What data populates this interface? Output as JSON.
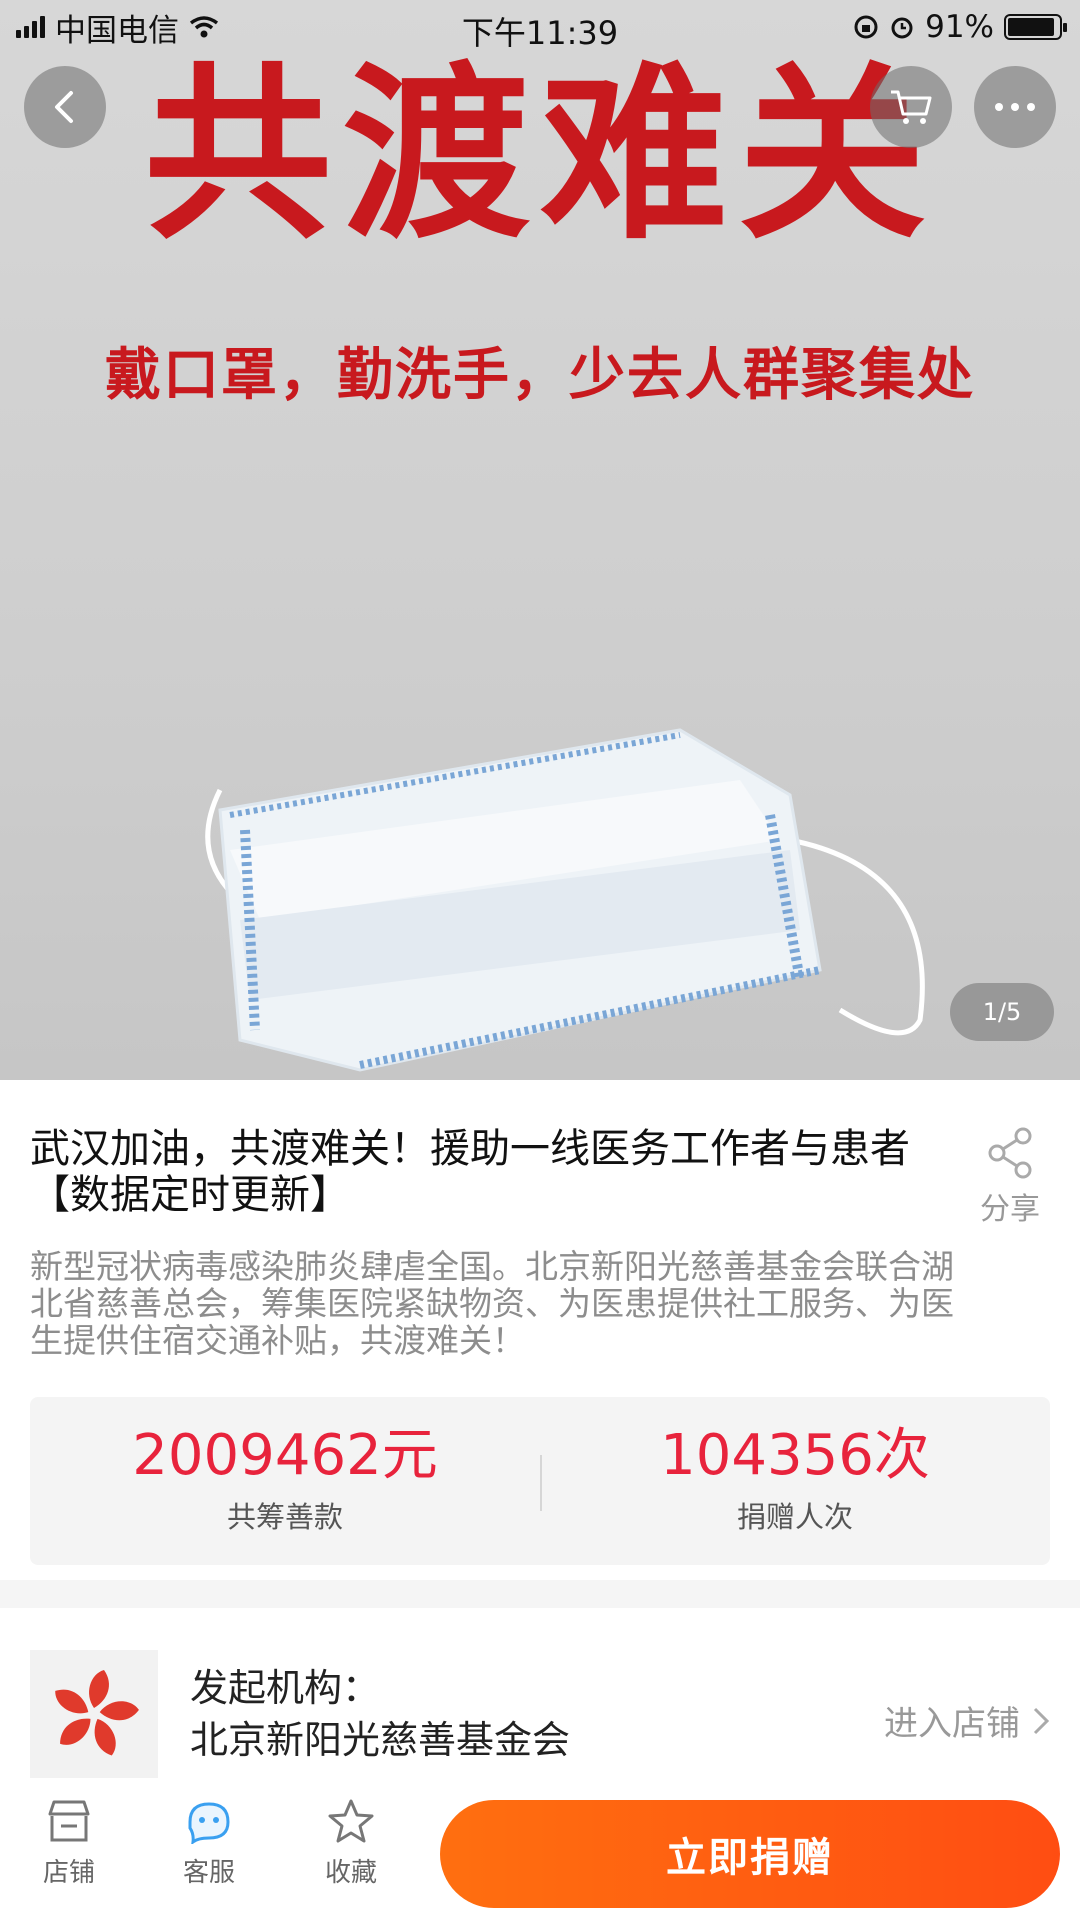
{
  "status_bar": {
    "carrier": "中国电信",
    "time": "下午11:39",
    "battery": "91%",
    "battery_level": 0.91
  },
  "hero": {
    "title": "共渡难关",
    "subtitle": "戴口罩，勤洗手，少去人群聚集处",
    "pager": "1/5"
  },
  "project": {
    "title": "武汉加油，共渡难关！援助一线医务工作者与患者【数据定时更新】",
    "share_label": "分享",
    "description": "新型冠状病毒感染肺炎肆虐全国。北京新阳光慈善基金会联合湖北省慈善总会，筹集医院紧缺物资、为医患提供社工服务、为医生提供住宿交通补贴，共渡难关！"
  },
  "stats": {
    "raised_value": "2009462元",
    "raised_label": "共筹善款",
    "donors_value": "104356次",
    "donors_label": "捐赠人次"
  },
  "org": {
    "label": "发起机构：",
    "name": "北京新阳光慈善基金会",
    "link": "进入店铺"
  },
  "bottom_bar": {
    "tabs": [
      {
        "label": "店铺",
        "icon": "store-icon"
      },
      {
        "label": "客服",
        "icon": "customer-service-icon"
      },
      {
        "label": "收藏",
        "icon": "star-icon"
      }
    ],
    "donate_label": "立即捐赠"
  },
  "colors": {
    "accent": "#ff5a10",
    "highlight": "#e8233c",
    "hero_red": "#c8191e"
  }
}
